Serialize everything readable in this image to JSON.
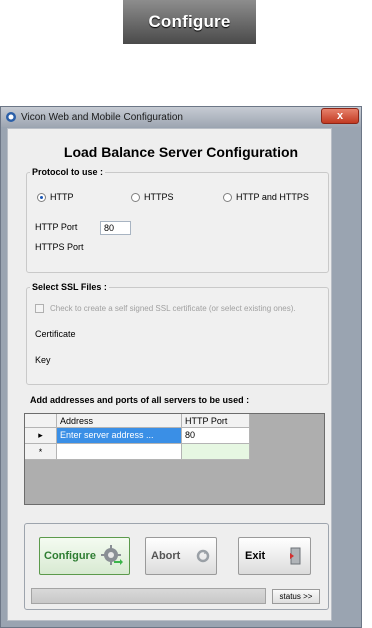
{
  "top_button": {
    "label": "Configure"
  },
  "window": {
    "title": "Vicon Web and Mobile Configuration",
    "close_label": "x"
  },
  "main": {
    "heading": "Load Balance Server Configuration",
    "protocol": {
      "legend": "Protocol to use :",
      "options": [
        {
          "label": "HTTP",
          "selected": true
        },
        {
          "label": "HTTPS",
          "selected": false
        },
        {
          "label": "HTTP and HTTPS",
          "selected": false
        }
      ],
      "http_port_label": "HTTP Port",
      "http_port_value": "80",
      "https_port_label": "HTTPS Port"
    },
    "ssl": {
      "legend": "Select SSL Files :",
      "checkbox_label": "Check to create a self signed SSL certificate (or select existing ones).",
      "certificate_label": "Certificate",
      "key_label": "Key"
    },
    "servers": {
      "legend": "Add addresses and ports of all servers to be used :",
      "columns": [
        "Address",
        "HTTP Port"
      ],
      "rows": [
        {
          "indicator": "▸",
          "address": "Enter server address ...",
          "port": "80"
        },
        {
          "indicator": "*",
          "address": "",
          "port": ""
        }
      ]
    }
  },
  "actions": {
    "configure_label": "Configure",
    "abort_label": "Abort",
    "exit_label": "Exit",
    "status_label": "status >>"
  },
  "colors": {
    "selection_blue": "#3a8fe6",
    "new_row_green": "#e6f7e2",
    "configure_text": "#2e7d32"
  },
  "icons": [
    "gear-icon",
    "refresh-icon",
    "exit-door-icon",
    "app-icon",
    "close-icon"
  ]
}
